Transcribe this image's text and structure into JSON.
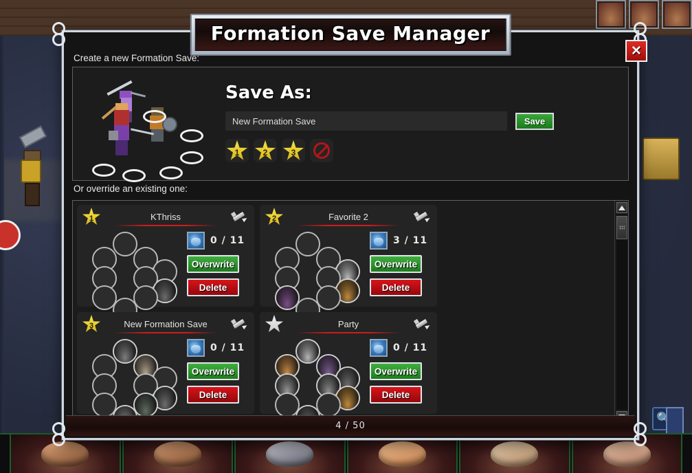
{
  "window": {
    "title": "Formation Save Manager",
    "close_label": "✕",
    "footer_count": "4 / 50"
  },
  "create_section": {
    "label": "Create a new Formation Save:",
    "save_as_title": "Save As:",
    "name_value": "New Formation Save",
    "name_placeholder": "New Formation Save",
    "save_button": "Save",
    "star_buttons": [
      {
        "name": "star-1-button",
        "label": "1",
        "type": "star"
      },
      {
        "name": "star-2-button",
        "label": "2",
        "type": "star"
      },
      {
        "name": "star-3-button",
        "label": "3",
        "type": "star"
      },
      {
        "name": "no-star-button",
        "label": "",
        "type": "none"
      }
    ]
  },
  "override_section": {
    "label": "Or override an existing one:",
    "overwrite_label": "Overwrite",
    "delete_label": "Delete",
    "edit_icon": "pencil-icon",
    "count_icon": "helmet-icon",
    "cards": [
      {
        "title": "KThriss",
        "star": "1",
        "star_style": "gold",
        "count": "0 / 11",
        "slots": [
          {
            "occupied": false
          },
          {
            "occupied": false
          },
          {
            "occupied": false
          },
          {
            "occupied": false
          },
          {
            "occupied": false
          },
          {
            "occupied": false
          },
          {
            "occupied": true,
            "tint": "#6b6b6b"
          },
          {
            "occupied": false
          },
          {
            "occupied": false
          },
          {
            "occupied": false
          },
          {
            "occupied": false
          }
        ]
      },
      {
        "title": "Favorite 2",
        "star": "2",
        "star_style": "gold",
        "count": "3 / 11",
        "slots": [
          {
            "occupied": false
          },
          {
            "occupied": false
          },
          {
            "occupied": false
          },
          {
            "occupied": true,
            "tint": "#b9b9b9"
          },
          {
            "occupied": false
          },
          {
            "occupied": false
          },
          {
            "occupied": true,
            "tint": "#c08a3c"
          },
          {
            "occupied": true,
            "tint": "#7a4f86"
          },
          {
            "occupied": false
          },
          {
            "occupied": false
          },
          {
            "occupied": false
          }
        ]
      },
      {
        "title": "New Formation Save",
        "star": "3",
        "star_style": "gold",
        "count": "0 / 11",
        "slots": [
          {
            "occupied": false
          },
          {
            "occupied": true,
            "tint": "#7d7d7d"
          },
          {
            "occupied": true,
            "tint": "#b0a08c"
          },
          {
            "occupied": false
          },
          {
            "occupied": false
          },
          {
            "occupied": false
          },
          {
            "occupied": true,
            "tint": "#6e6e6e"
          },
          {
            "occupied": false
          },
          {
            "occupied": true,
            "tint": "#8a8a8a"
          },
          {
            "occupied": true,
            "tint": "#5f6b60"
          },
          {
            "occupied": true,
            "tint": "#7a8a7a"
          }
        ]
      },
      {
        "title": "Party",
        "star": "",
        "star_style": "white",
        "count": "0 / 11",
        "slots": [
          {
            "occupied": true,
            "tint": "#c98a48"
          },
          {
            "occupied": true,
            "tint": "#b5b5b5"
          },
          {
            "occupied": true,
            "tint": "#7a5d90"
          },
          {
            "occupied": true,
            "tint": "#6e6e6e"
          },
          {
            "occupied": true,
            "tint": "#9a9a9a"
          },
          {
            "occupied": true,
            "tint": "#8f8f8f"
          },
          {
            "occupied": true,
            "tint": "#c08a3c"
          },
          {
            "occupied": false
          },
          {
            "occupied": true,
            "tint": "#6d6d6d"
          },
          {
            "occupied": false
          },
          {
            "occupied": false
          }
        ]
      }
    ]
  },
  "preview": {
    "slot_markers": 6,
    "characters": 3
  },
  "colors": {
    "accent_green": "#3fae3f",
    "accent_red": "#d6141a",
    "star_gold": "#f2d93c",
    "panel_bg": "#1c1c1c",
    "card_bg": "#242424",
    "frame": "#cfd6de"
  }
}
